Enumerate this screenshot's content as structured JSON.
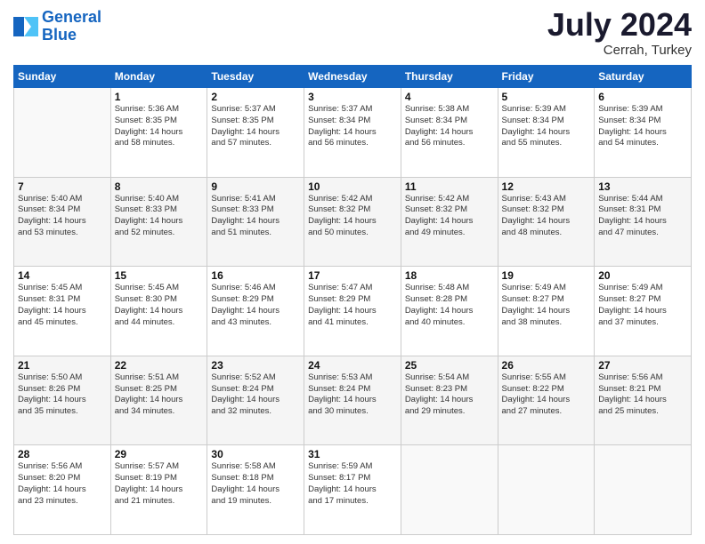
{
  "header": {
    "logo_line1": "General",
    "logo_line2": "Blue",
    "month_year": "July 2024",
    "location": "Cerrah, Turkey"
  },
  "weekdays": [
    "Sunday",
    "Monday",
    "Tuesday",
    "Wednesday",
    "Thursday",
    "Friday",
    "Saturday"
  ],
  "weeks": [
    [
      {
        "day": "",
        "info": ""
      },
      {
        "day": "1",
        "info": "Sunrise: 5:36 AM\nSunset: 8:35 PM\nDaylight: 14 hours\nand 58 minutes."
      },
      {
        "day": "2",
        "info": "Sunrise: 5:37 AM\nSunset: 8:35 PM\nDaylight: 14 hours\nand 57 minutes."
      },
      {
        "day": "3",
        "info": "Sunrise: 5:37 AM\nSunset: 8:34 PM\nDaylight: 14 hours\nand 56 minutes."
      },
      {
        "day": "4",
        "info": "Sunrise: 5:38 AM\nSunset: 8:34 PM\nDaylight: 14 hours\nand 56 minutes."
      },
      {
        "day": "5",
        "info": "Sunrise: 5:39 AM\nSunset: 8:34 PM\nDaylight: 14 hours\nand 55 minutes."
      },
      {
        "day": "6",
        "info": "Sunrise: 5:39 AM\nSunset: 8:34 PM\nDaylight: 14 hours\nand 54 minutes."
      }
    ],
    [
      {
        "day": "7",
        "info": "Sunrise: 5:40 AM\nSunset: 8:34 PM\nDaylight: 14 hours\nand 53 minutes."
      },
      {
        "day": "8",
        "info": "Sunrise: 5:40 AM\nSunset: 8:33 PM\nDaylight: 14 hours\nand 52 minutes."
      },
      {
        "day": "9",
        "info": "Sunrise: 5:41 AM\nSunset: 8:33 PM\nDaylight: 14 hours\nand 51 minutes."
      },
      {
        "day": "10",
        "info": "Sunrise: 5:42 AM\nSunset: 8:32 PM\nDaylight: 14 hours\nand 50 minutes."
      },
      {
        "day": "11",
        "info": "Sunrise: 5:42 AM\nSunset: 8:32 PM\nDaylight: 14 hours\nand 49 minutes."
      },
      {
        "day": "12",
        "info": "Sunrise: 5:43 AM\nSunset: 8:32 PM\nDaylight: 14 hours\nand 48 minutes."
      },
      {
        "day": "13",
        "info": "Sunrise: 5:44 AM\nSunset: 8:31 PM\nDaylight: 14 hours\nand 47 minutes."
      }
    ],
    [
      {
        "day": "14",
        "info": "Sunrise: 5:45 AM\nSunset: 8:31 PM\nDaylight: 14 hours\nand 45 minutes."
      },
      {
        "day": "15",
        "info": "Sunrise: 5:45 AM\nSunset: 8:30 PM\nDaylight: 14 hours\nand 44 minutes."
      },
      {
        "day": "16",
        "info": "Sunrise: 5:46 AM\nSunset: 8:29 PM\nDaylight: 14 hours\nand 43 minutes."
      },
      {
        "day": "17",
        "info": "Sunrise: 5:47 AM\nSunset: 8:29 PM\nDaylight: 14 hours\nand 41 minutes."
      },
      {
        "day": "18",
        "info": "Sunrise: 5:48 AM\nSunset: 8:28 PM\nDaylight: 14 hours\nand 40 minutes."
      },
      {
        "day": "19",
        "info": "Sunrise: 5:49 AM\nSunset: 8:27 PM\nDaylight: 14 hours\nand 38 minutes."
      },
      {
        "day": "20",
        "info": "Sunrise: 5:49 AM\nSunset: 8:27 PM\nDaylight: 14 hours\nand 37 minutes."
      }
    ],
    [
      {
        "day": "21",
        "info": "Sunrise: 5:50 AM\nSunset: 8:26 PM\nDaylight: 14 hours\nand 35 minutes."
      },
      {
        "day": "22",
        "info": "Sunrise: 5:51 AM\nSunset: 8:25 PM\nDaylight: 14 hours\nand 34 minutes."
      },
      {
        "day": "23",
        "info": "Sunrise: 5:52 AM\nSunset: 8:24 PM\nDaylight: 14 hours\nand 32 minutes."
      },
      {
        "day": "24",
        "info": "Sunrise: 5:53 AM\nSunset: 8:24 PM\nDaylight: 14 hours\nand 30 minutes."
      },
      {
        "day": "25",
        "info": "Sunrise: 5:54 AM\nSunset: 8:23 PM\nDaylight: 14 hours\nand 29 minutes."
      },
      {
        "day": "26",
        "info": "Sunrise: 5:55 AM\nSunset: 8:22 PM\nDaylight: 14 hours\nand 27 minutes."
      },
      {
        "day": "27",
        "info": "Sunrise: 5:56 AM\nSunset: 8:21 PM\nDaylight: 14 hours\nand 25 minutes."
      }
    ],
    [
      {
        "day": "28",
        "info": "Sunrise: 5:56 AM\nSunset: 8:20 PM\nDaylight: 14 hours\nand 23 minutes."
      },
      {
        "day": "29",
        "info": "Sunrise: 5:57 AM\nSunset: 8:19 PM\nDaylight: 14 hours\nand 21 minutes."
      },
      {
        "day": "30",
        "info": "Sunrise: 5:58 AM\nSunset: 8:18 PM\nDaylight: 14 hours\nand 19 minutes."
      },
      {
        "day": "31",
        "info": "Sunrise: 5:59 AM\nSunset: 8:17 PM\nDaylight: 14 hours\nand 17 minutes."
      },
      {
        "day": "",
        "info": ""
      },
      {
        "day": "",
        "info": ""
      },
      {
        "day": "",
        "info": ""
      }
    ]
  ]
}
